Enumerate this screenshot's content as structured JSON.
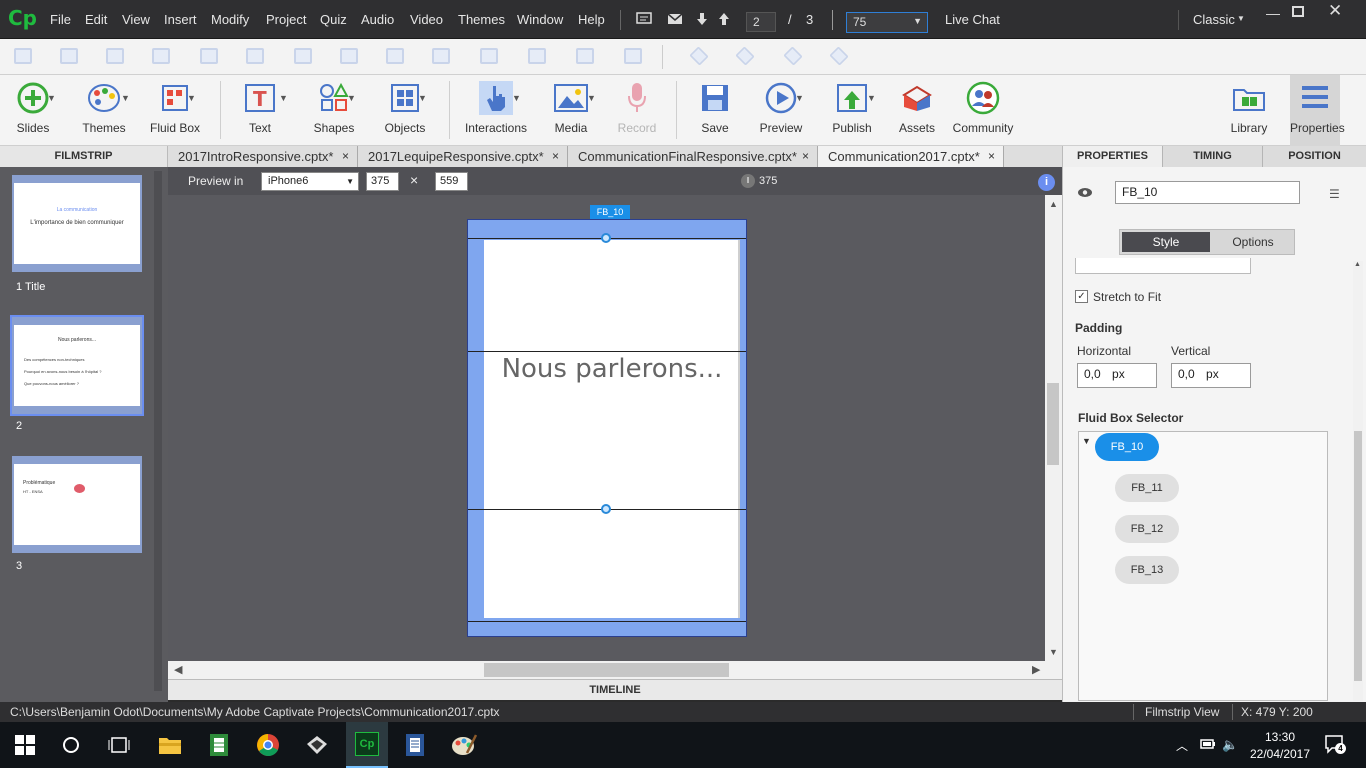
{
  "app": {
    "logo": "Cp",
    "menus": [
      "File",
      "Edit",
      "View",
      "Insert",
      "Modify",
      "Project",
      "Quiz",
      "Audio",
      "Video",
      "Themes",
      "Window",
      "Help"
    ],
    "page_current": "2",
    "page_sep": "/",
    "page_total": "3",
    "zoom": "75",
    "live_chat": "Live Chat",
    "workspace": "Classic"
  },
  "toolbar": {
    "items": [
      {
        "label": "Slides",
        "icon": "plus-circle-icon",
        "color": "#3aaa3a"
      },
      {
        "label": "Themes",
        "icon": "palette-icon",
        "color": "#4a76c9"
      },
      {
        "label": "Fluid Box",
        "icon": "fluid-box-icon",
        "color": "#c0392b"
      },
      {
        "label": "Text",
        "icon": "text-icon",
        "color": "#d9534f"
      },
      {
        "label": "Shapes",
        "icon": "shapes-icon",
        "color": "#4a76c9"
      },
      {
        "label": "Objects",
        "icon": "objects-icon",
        "color": "#4a76c9"
      },
      {
        "label": "Interactions",
        "icon": "hand-icon",
        "color": "#4a76c9"
      },
      {
        "label": "Media",
        "icon": "image-icon",
        "color": "#4a76c9"
      },
      {
        "label": "Record",
        "icon": "mic-icon",
        "color": "#e9a3b0"
      },
      {
        "label": "Save",
        "icon": "save-icon",
        "color": "#4a76c9"
      },
      {
        "label": "Preview",
        "icon": "play-icon",
        "color": "#4a76c9"
      },
      {
        "label": "Publish",
        "icon": "publish-icon",
        "color": "#3aaa3a"
      },
      {
        "label": "Assets",
        "icon": "assets-icon",
        "color": "#c0392b"
      },
      {
        "label": "Community",
        "icon": "community-icon",
        "color": "#3aaa3a"
      },
      {
        "label": "Library",
        "icon": "library-icon",
        "color": "#4a76c9"
      },
      {
        "label": "Properties",
        "icon": "properties-icon",
        "color": "#4a76c9"
      }
    ]
  },
  "filmstrip": {
    "header": "FILMSTRIP",
    "slides": [
      {
        "label": "1 Title",
        "line1": "La communication",
        "line2": "L'importance de bien communiquer"
      },
      {
        "label": "2",
        "line1": "Nous parlerons...",
        "line2": "Des compétences non-techniques",
        "line3": "Pourquoi en avons-nous besoin à l'hôpital ?",
        "line4": "Que pouvons-nous améliorer ?"
      },
      {
        "label": "3",
        "line1": "Problématique",
        "line2": "HT - ENSA"
      }
    ]
  },
  "tabs": [
    {
      "label": "2017IntroResponsive.cptx*",
      "close": "×"
    },
    {
      "label": "2017LequipeResponsive.cptx*",
      "close": "×"
    },
    {
      "label": "CommunicationFinalResponsive.cptx*",
      "close": "×"
    },
    {
      "label": "Communication2017.cptx*",
      "close": "×"
    }
  ],
  "preview": {
    "label": "Preview in",
    "device": "iPhone6",
    "width": "375",
    "times": "×",
    "height": "559",
    "ruler_value": "375",
    "fluid_tag": "FB_10"
  },
  "slide": {
    "title": "Nous parlerons..."
  },
  "timeline": "TIMELINE",
  "properties": {
    "tabs": [
      "PROPERTIES",
      "TIMING",
      "POSITION"
    ],
    "name": "FB_10",
    "style_tab": "Style",
    "options_tab": "Options",
    "stretch": "Stretch to Fit",
    "padding": "Padding",
    "horizontal": "Horizontal",
    "vertical": "Vertical",
    "h_value": "0,0",
    "v_value": "0,0",
    "unit": "px",
    "selector_title": "Fluid Box Selector",
    "boxes": [
      "FB_10",
      "FB_11",
      "FB_12",
      "FB_13"
    ]
  },
  "status": {
    "path": "C:\\Users\\Benjamin Odot\\Documents\\My Adobe Captivate Projects\\Communication2017.cptx",
    "view": "Filmstrip View",
    "coords": "X: 479 Y: 200"
  },
  "taskbar": {
    "time": "13:30",
    "date": "22/04/2017",
    "notifications": "4"
  }
}
